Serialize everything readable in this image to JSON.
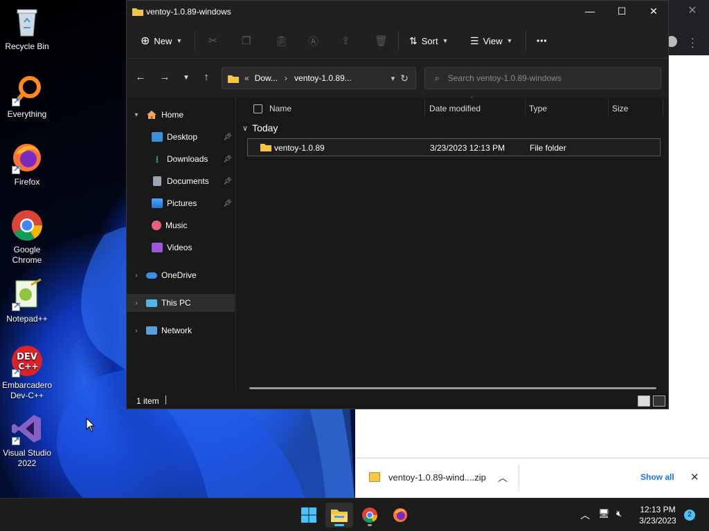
{
  "desktop": {
    "icons": [
      {
        "label": "Recycle Bin"
      },
      {
        "label": "Everything"
      },
      {
        "label": "Firefox"
      },
      {
        "label": "Google Chrome"
      },
      {
        "label": "Notepad++"
      },
      {
        "label": "Embarcadero Dev-C++"
      },
      {
        "label": "Visual Studio 2022"
      }
    ]
  },
  "explorer": {
    "title": "ventoy-1.0.89-windows",
    "toolbar": {
      "new_label": "New",
      "sort_label": "Sort",
      "view_label": "View",
      "more_label": "•••"
    },
    "address": {
      "overflow": "«",
      "segments": [
        "Dow...",
        "ventoy-1.0.89..."
      ]
    },
    "search": {
      "placeholder": "Search ventoy-1.0.89-windows"
    },
    "sidebar": {
      "home": "Home",
      "quick": [
        {
          "label": "Desktop",
          "pinned": true
        },
        {
          "label": "Downloads",
          "pinned": true
        },
        {
          "label": "Documents",
          "pinned": true
        },
        {
          "label": "Pictures",
          "pinned": true
        },
        {
          "label": "Music",
          "pinned": false
        },
        {
          "label": "Videos",
          "pinned": false
        }
      ],
      "onedrive": "OneDrive",
      "thispc": "This PC",
      "network": "Network"
    },
    "columns": {
      "name": "Name",
      "date": "Date modified",
      "type": "Type",
      "size": "Size"
    },
    "group": "Today",
    "files": [
      {
        "name": "ventoy-1.0.89",
        "date": "3/23/2023 12:13 PM",
        "type": "File folder",
        "size": ""
      }
    ],
    "status": {
      "count": "1 item"
    }
  },
  "download_bar": {
    "file": "ventoy-1.0.89-wind....zip",
    "show_all": "Show all"
  },
  "taskbar": {
    "time": "12:13 PM",
    "date": "3/23/2023",
    "notifications": "2"
  },
  "colors": {
    "accent": "#4cc2ff",
    "folder": "#f4c542",
    "link": "#1a73e8"
  }
}
